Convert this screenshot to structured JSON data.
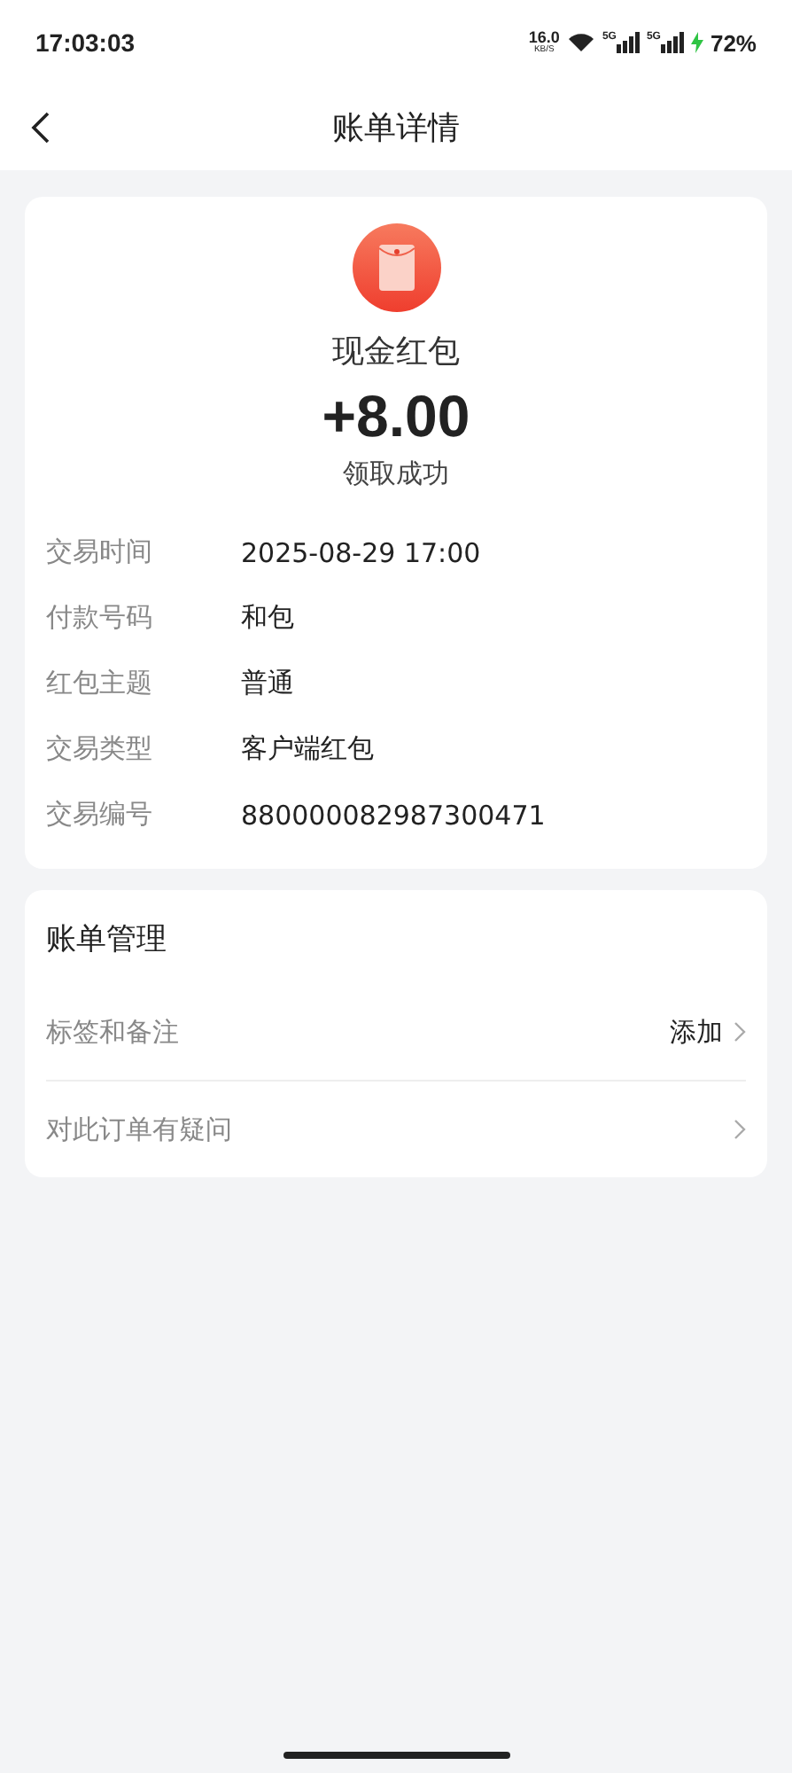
{
  "status_bar": {
    "time": "17:03:03",
    "speed": "16.0",
    "speed_unit": "KB/S",
    "sim_labels": [
      "5G",
      "5G"
    ],
    "battery": "72%"
  },
  "nav": {
    "title": "账单详情"
  },
  "summary": {
    "title": "现金红包",
    "amount": "+8.00",
    "status": "领取成功"
  },
  "details": [
    {
      "label": "交易时间",
      "value": "2025-08-29 17:00"
    },
    {
      "label": "付款号码",
      "value": "和包"
    },
    {
      "label": "红包主题",
      "value": "普通"
    },
    {
      "label": "交易类型",
      "value": "客户端红包"
    },
    {
      "label": "交易编号",
      "value": "880000082987300471"
    }
  ],
  "management": {
    "title": "账单管理",
    "items": [
      {
        "label": "标签和备注",
        "action": "添加"
      },
      {
        "label": "对此订单有疑问"
      }
    ]
  }
}
